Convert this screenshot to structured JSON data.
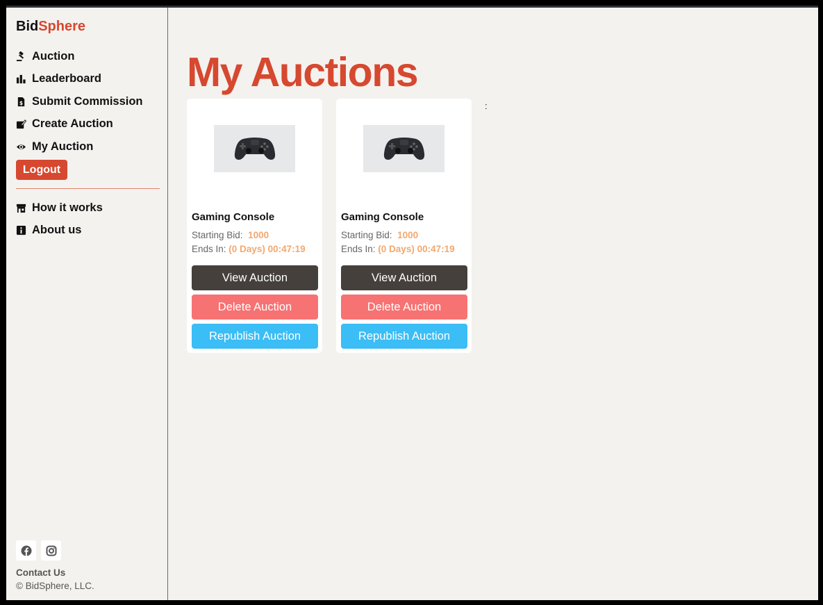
{
  "brand": {
    "part1": "Bid",
    "part2": "Sphere"
  },
  "sidebar": {
    "items": [
      {
        "label": "Auction",
        "icon": "gavel-icon"
      },
      {
        "label": "Leaderboard",
        "icon": "bar-chart-icon"
      },
      {
        "label": "Submit Commission",
        "icon": "dollar-file-icon"
      },
      {
        "label": "Create Auction",
        "icon": "edit-icon"
      },
      {
        "label": "My Auction",
        "icon": "eye-icon"
      }
    ],
    "logout_label": "Logout",
    "secondary_items": [
      {
        "label": "How it works",
        "icon": "store-icon"
      },
      {
        "label": "About us",
        "icon": "info-icon"
      }
    ],
    "social": [
      "facebook-icon",
      "instagram-icon"
    ],
    "contact_label": "Contact Us",
    "copyright": "© BidSphere, LLC."
  },
  "main": {
    "title": "My Auctions",
    "stray_text": ":",
    "cards": [
      {
        "name": "Gaming Console",
        "starting_bid_label": "Starting Bid:",
        "starting_bid": "1000",
        "ends_in_label": "Ends In:",
        "ends_in": "(0 Days) 00:47:19",
        "view_label": "View Auction",
        "delete_label": "Delete Auction",
        "republish_label": "Republish Auction"
      },
      {
        "name": "Gaming Console",
        "starting_bid_label": "Starting Bid:",
        "starting_bid": "1000",
        "ends_in_label": "Ends In:",
        "ends_in": "(0 Days) 00:47:19",
        "view_label": "View Auction",
        "delete_label": "Delete Auction",
        "republish_label": "Republish Auction"
      }
    ]
  },
  "colors": {
    "accent": "#d6482f",
    "view_button": "#45403b",
    "delete_button": "#f77272",
    "republish_button": "#3bbdf6",
    "value_text": "#f2a86f"
  }
}
